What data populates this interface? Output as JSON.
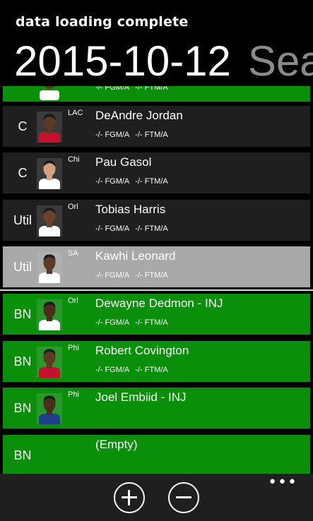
{
  "status": "data loading complete",
  "pivot": {
    "current": "2015-10-12",
    "next": "Sea"
  },
  "partial_row": {
    "stats_fgm": "-/- FGM/A",
    "stats_ftm": "-/- FTM/A"
  },
  "rows": [
    {
      "pos": "C",
      "team": "LAC",
      "name": "DeAndre Jordan",
      "fgm": "-/- FGM/A",
      "ftm": "-/- FTM/A",
      "style": "dark",
      "skin": "#5a3a24",
      "jersey": "#c8102e"
    },
    {
      "pos": "C",
      "team": "Chi",
      "name": "Pau Gasol",
      "fgm": "-/- FGM/A",
      "ftm": "-/- FTM/A",
      "style": "dark",
      "skin": "#d2a17e",
      "jersey": "#ffffff"
    },
    {
      "pos": "Util",
      "team": "Orl",
      "name": "Tobias Harris",
      "fgm": "-/- FGM/A",
      "ftm": "-/- FTM/A",
      "style": "dark",
      "skin": "#6b4329",
      "jersey": "#ffffff"
    },
    {
      "pos": "Util",
      "team": "SA",
      "name": "Kawhi Leonard",
      "fgm": "-/- FGM/A",
      "ftm": "-/- FTM/A",
      "style": "selected",
      "skin": "#5b3a26",
      "jersey": "#ffffff"
    },
    {
      "pos": "BN",
      "team": "Orl",
      "name": "Dewayne Dedmon - INJ",
      "fgm": "-/- FGM/A",
      "ftm": "-/- FTM/A",
      "style": "green",
      "skin": "#4b2e1d",
      "jersey": "#ffffff"
    },
    {
      "pos": "BN",
      "team": "Phi",
      "name": "Robert Covington",
      "fgm": "-/- FGM/A",
      "ftm": "-/- FTM/A",
      "style": "green",
      "skin": "#5d3a24",
      "jersey": "#c8102e"
    },
    {
      "pos": "BN",
      "team": "Phi",
      "name": "Joel Embiid - INJ",
      "fgm": "",
      "ftm": "",
      "style": "green",
      "skin": "#4a2d1c",
      "jersey": "#1d428a"
    },
    {
      "pos": "BN",
      "team": "",
      "name": "(Empty)",
      "fgm": "",
      "ftm": "",
      "style": "green",
      "skin": "",
      "jersey": ""
    }
  ],
  "appbar": {
    "add_icon": "plus-circle-icon",
    "remove_icon": "minus-circle-icon",
    "more": "•••"
  },
  "colors": {
    "green": "#0a8f0a",
    "dark_row": "#1f1f1f",
    "selected_row": "#a8a8a8",
    "pivot_inactive": "#8a8a8a"
  }
}
